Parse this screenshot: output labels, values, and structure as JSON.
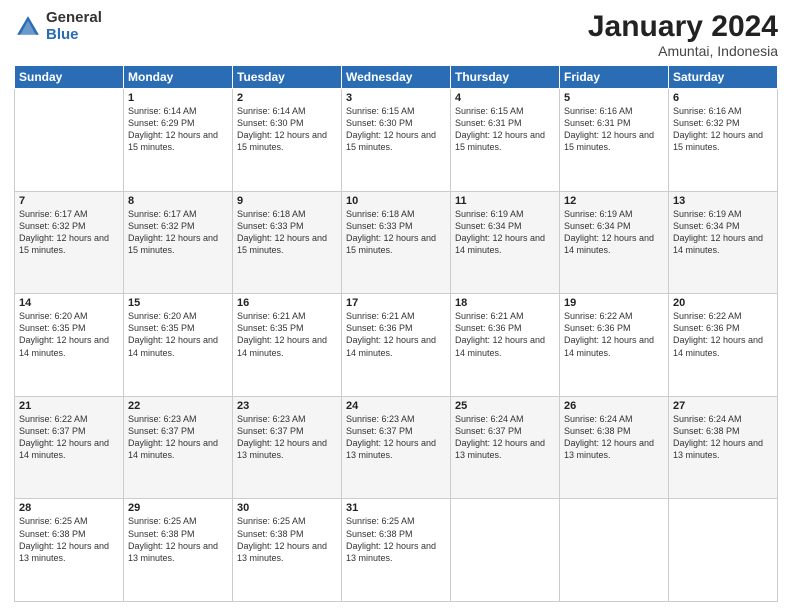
{
  "logo": {
    "general": "General",
    "blue": "Blue"
  },
  "header": {
    "title": "January 2024",
    "subtitle": "Amuntai, Indonesia"
  },
  "weekdays": [
    "Sunday",
    "Monday",
    "Tuesday",
    "Wednesday",
    "Thursday",
    "Friday",
    "Saturday"
  ],
  "weeks": [
    [
      {
        "day": "",
        "sunrise": "",
        "sunset": "",
        "daylight": ""
      },
      {
        "day": "1",
        "sunrise": "6:14 AM",
        "sunset": "6:29 PM",
        "daylight": "12 hours and 15 minutes."
      },
      {
        "day": "2",
        "sunrise": "6:14 AM",
        "sunset": "6:30 PM",
        "daylight": "12 hours and 15 minutes."
      },
      {
        "day": "3",
        "sunrise": "6:15 AM",
        "sunset": "6:30 PM",
        "daylight": "12 hours and 15 minutes."
      },
      {
        "day": "4",
        "sunrise": "6:15 AM",
        "sunset": "6:31 PM",
        "daylight": "12 hours and 15 minutes."
      },
      {
        "day": "5",
        "sunrise": "6:16 AM",
        "sunset": "6:31 PM",
        "daylight": "12 hours and 15 minutes."
      },
      {
        "day": "6",
        "sunrise": "6:16 AM",
        "sunset": "6:32 PM",
        "daylight": "12 hours and 15 minutes."
      }
    ],
    [
      {
        "day": "7",
        "sunrise": "6:17 AM",
        "sunset": "6:32 PM",
        "daylight": "12 hours and 15 minutes."
      },
      {
        "day": "8",
        "sunrise": "6:17 AM",
        "sunset": "6:32 PM",
        "daylight": "12 hours and 15 minutes."
      },
      {
        "day": "9",
        "sunrise": "6:18 AM",
        "sunset": "6:33 PM",
        "daylight": "12 hours and 15 minutes."
      },
      {
        "day": "10",
        "sunrise": "6:18 AM",
        "sunset": "6:33 PM",
        "daylight": "12 hours and 15 minutes."
      },
      {
        "day": "11",
        "sunrise": "6:19 AM",
        "sunset": "6:34 PM",
        "daylight": "12 hours and 14 minutes."
      },
      {
        "day": "12",
        "sunrise": "6:19 AM",
        "sunset": "6:34 PM",
        "daylight": "12 hours and 14 minutes."
      },
      {
        "day": "13",
        "sunrise": "6:19 AM",
        "sunset": "6:34 PM",
        "daylight": "12 hours and 14 minutes."
      }
    ],
    [
      {
        "day": "14",
        "sunrise": "6:20 AM",
        "sunset": "6:35 PM",
        "daylight": "12 hours and 14 minutes."
      },
      {
        "day": "15",
        "sunrise": "6:20 AM",
        "sunset": "6:35 PM",
        "daylight": "12 hours and 14 minutes."
      },
      {
        "day": "16",
        "sunrise": "6:21 AM",
        "sunset": "6:35 PM",
        "daylight": "12 hours and 14 minutes."
      },
      {
        "day": "17",
        "sunrise": "6:21 AM",
        "sunset": "6:36 PM",
        "daylight": "12 hours and 14 minutes."
      },
      {
        "day": "18",
        "sunrise": "6:21 AM",
        "sunset": "6:36 PM",
        "daylight": "12 hours and 14 minutes."
      },
      {
        "day": "19",
        "sunrise": "6:22 AM",
        "sunset": "6:36 PM",
        "daylight": "12 hours and 14 minutes."
      },
      {
        "day": "20",
        "sunrise": "6:22 AM",
        "sunset": "6:36 PM",
        "daylight": "12 hours and 14 minutes."
      }
    ],
    [
      {
        "day": "21",
        "sunrise": "6:22 AM",
        "sunset": "6:37 PM",
        "daylight": "12 hours and 14 minutes."
      },
      {
        "day": "22",
        "sunrise": "6:23 AM",
        "sunset": "6:37 PM",
        "daylight": "12 hours and 14 minutes."
      },
      {
        "day": "23",
        "sunrise": "6:23 AM",
        "sunset": "6:37 PM",
        "daylight": "12 hours and 13 minutes."
      },
      {
        "day": "24",
        "sunrise": "6:23 AM",
        "sunset": "6:37 PM",
        "daylight": "12 hours and 13 minutes."
      },
      {
        "day": "25",
        "sunrise": "6:24 AM",
        "sunset": "6:37 PM",
        "daylight": "12 hours and 13 minutes."
      },
      {
        "day": "26",
        "sunrise": "6:24 AM",
        "sunset": "6:38 PM",
        "daylight": "12 hours and 13 minutes."
      },
      {
        "day": "27",
        "sunrise": "6:24 AM",
        "sunset": "6:38 PM",
        "daylight": "12 hours and 13 minutes."
      }
    ],
    [
      {
        "day": "28",
        "sunrise": "6:25 AM",
        "sunset": "6:38 PM",
        "daylight": "12 hours and 13 minutes."
      },
      {
        "day": "29",
        "sunrise": "6:25 AM",
        "sunset": "6:38 PM",
        "daylight": "12 hours and 13 minutes."
      },
      {
        "day": "30",
        "sunrise": "6:25 AM",
        "sunset": "6:38 PM",
        "daylight": "12 hours and 13 minutes."
      },
      {
        "day": "31",
        "sunrise": "6:25 AM",
        "sunset": "6:38 PM",
        "daylight": "12 hours and 13 minutes."
      },
      {
        "day": "",
        "sunrise": "",
        "sunset": "",
        "daylight": ""
      },
      {
        "day": "",
        "sunrise": "",
        "sunset": "",
        "daylight": ""
      },
      {
        "day": "",
        "sunrise": "",
        "sunset": "",
        "daylight": ""
      }
    ]
  ],
  "labels": {
    "sunrise_prefix": "Sunrise: ",
    "sunset_prefix": "Sunset: ",
    "daylight_prefix": "Daylight: "
  }
}
